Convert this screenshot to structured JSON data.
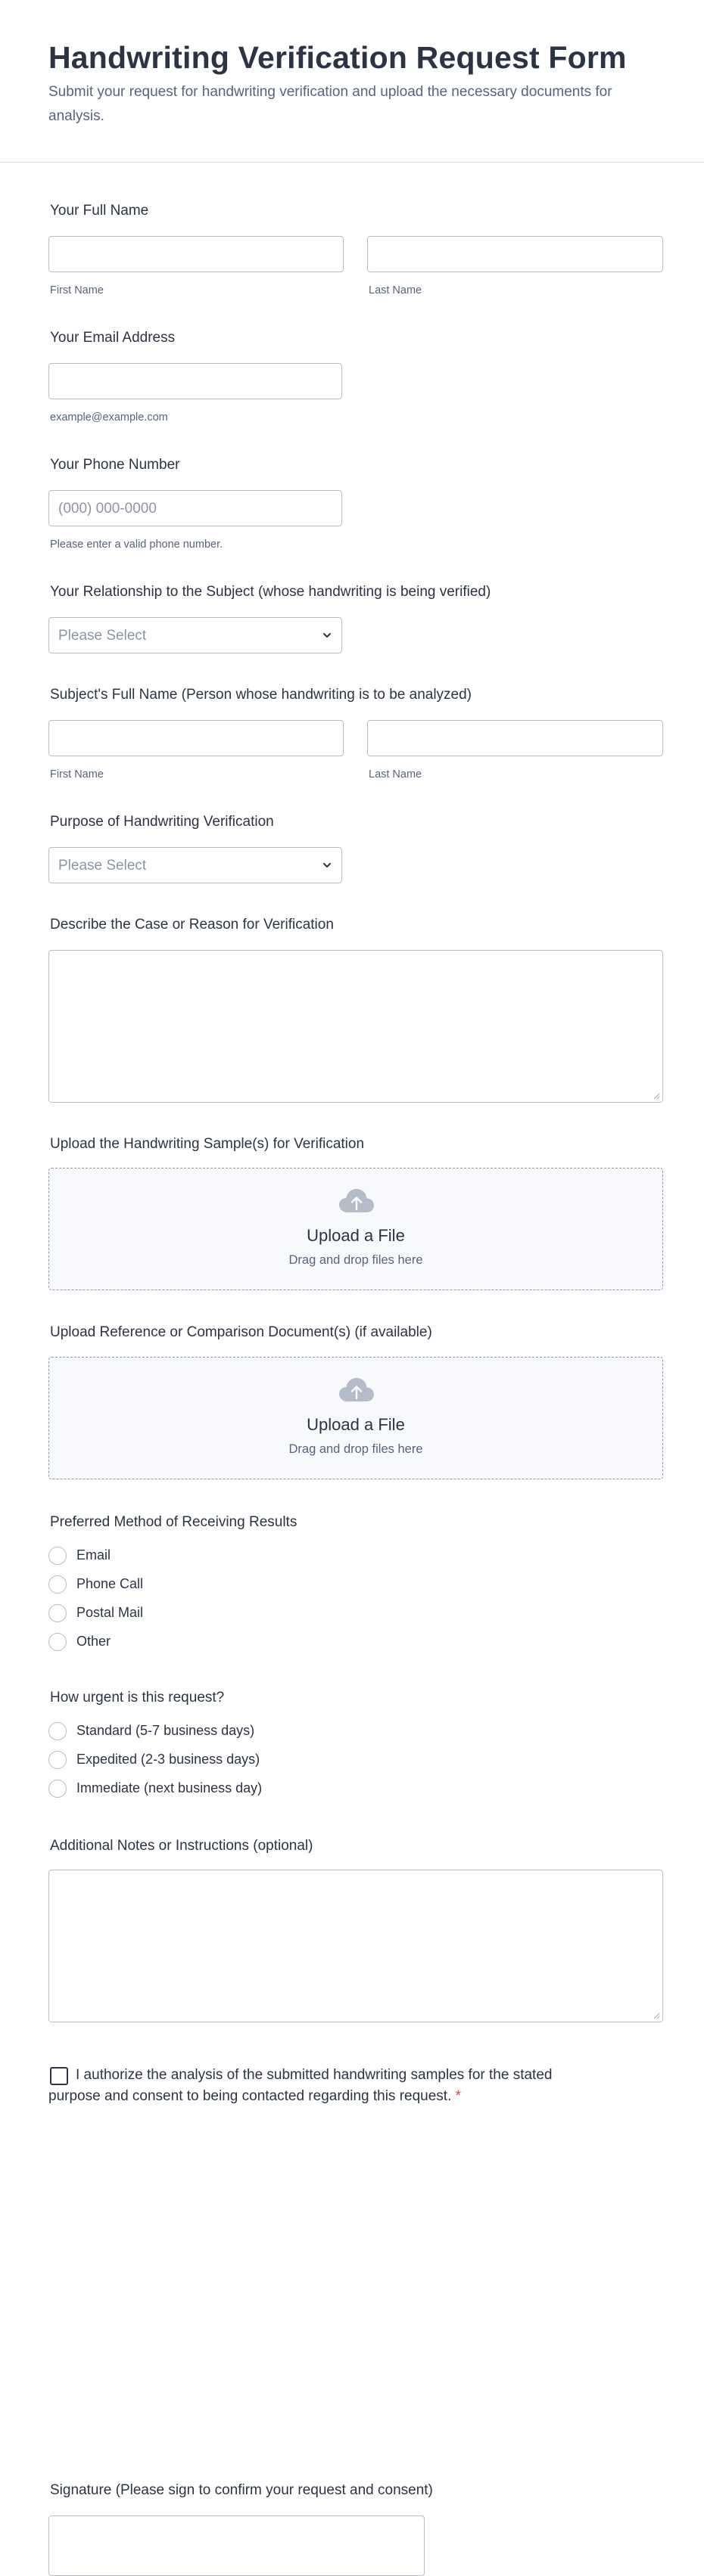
{
  "header": {
    "title": "Handwriting Verification Request Form",
    "subtitle": "Submit your request for handwriting verification and upload the necessary documents for analysis."
  },
  "full_name": {
    "label": "Your Full Name",
    "first_sublabel": "First Name",
    "last_sublabel": "Last Name",
    "first_value": "",
    "last_value": ""
  },
  "email": {
    "label": "Your Email Address",
    "value": "",
    "sublabel": "example@example.com"
  },
  "phone": {
    "label": "Your Phone Number",
    "placeholder": "(000) 000-0000",
    "sublabel": "Please enter a valid phone number."
  },
  "relationship": {
    "label": "Your Relationship to the Subject (whose handwriting is being verified)",
    "selected": "Please Select"
  },
  "subject_name": {
    "label": "Subject's Full Name (Person whose handwriting is to be analyzed)",
    "first_sublabel": "First Name",
    "last_sublabel": "Last Name"
  },
  "purpose": {
    "label": "Purpose of Handwriting Verification",
    "selected": "Please Select"
  },
  "case_description": {
    "label": "Describe the Case or Reason for Verification",
    "value": ""
  },
  "upload_samples": {
    "label": "Upload the Handwriting Sample(s) for Verification",
    "title": "Upload a File",
    "hint": "Drag and drop files here"
  },
  "upload_reference": {
    "label": "Upload Reference or Comparison Document(s) (if available)",
    "title": "Upload a File",
    "hint": "Drag and drop files here"
  },
  "results_method": {
    "label": "Preferred Method of Receiving Results",
    "options": [
      "Email",
      "Phone Call",
      "Postal Mail",
      "Other"
    ]
  },
  "urgency": {
    "label": "How urgent is this request?",
    "options": [
      "Standard (5-7 business days)",
      "Expedited (2-3 business days)",
      "Immediate (next business day)"
    ]
  },
  "notes": {
    "label": "Additional Notes or Instructions (optional)",
    "value": ""
  },
  "consent": {
    "text": "I authorize the analysis of the submitted handwriting samples for the stated purpose and consent to being contacted regarding this request.",
    "required_mark": "*",
    "checked": false
  },
  "signature": {
    "label": "Signature (Please sign to confirm your request and consent)"
  },
  "icons": {
    "select_chevron": "chevron-down-icon",
    "upload_cloud": "cloud-upload-icon",
    "resize_grip": "resize-grip-icon"
  },
  "colors": {
    "text": "#2c3345",
    "muted": "#57647e",
    "border": "#b8bdc9",
    "upload_bg": "#f8f9fd",
    "required": "#f23a3c"
  }
}
